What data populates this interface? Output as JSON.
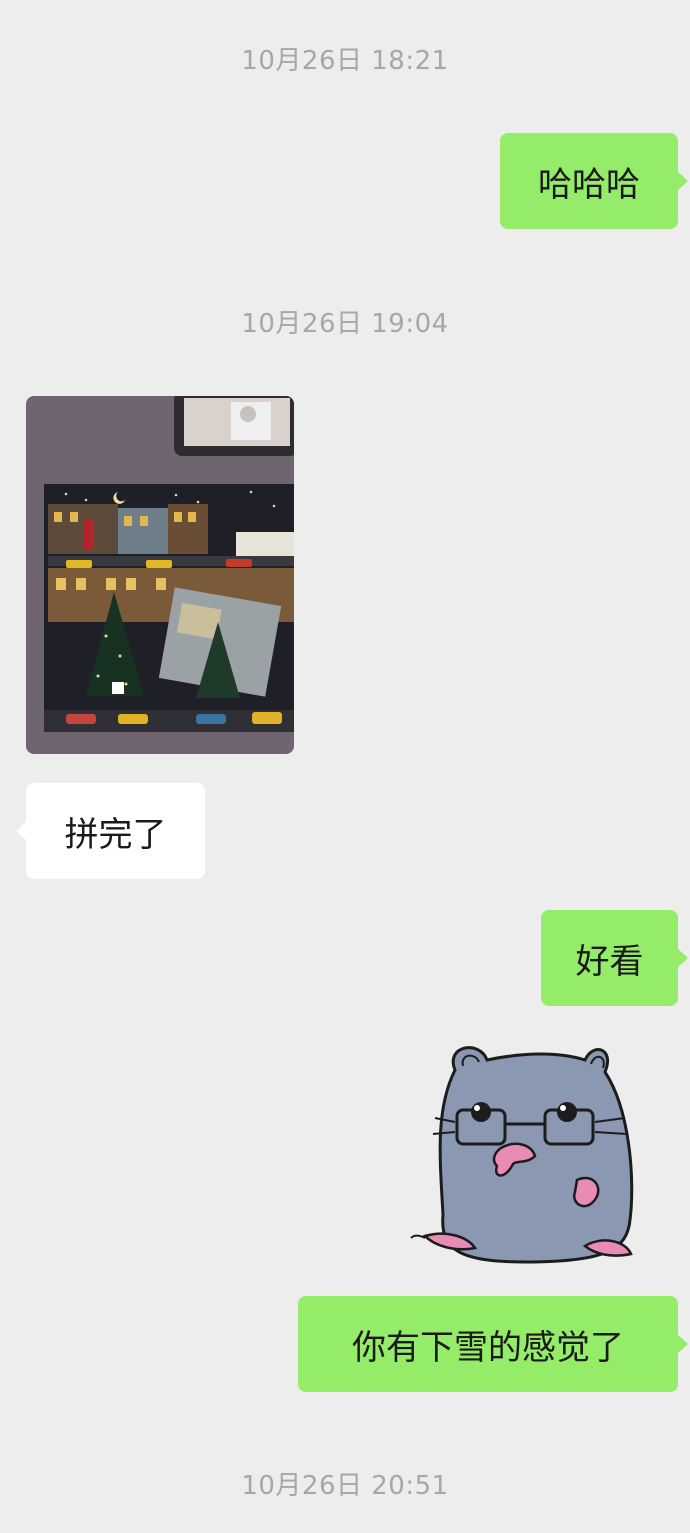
{
  "chat": {
    "timestamps": [
      "10月26日 18:21",
      "10月26日 19:04",
      "10月26日 20:51"
    ],
    "messages": {
      "m1": "哈哈哈",
      "m2": "拼完了",
      "m3": "好看",
      "m4": "你有下雪的感觉了"
    }
  },
  "colors": {
    "background": "#ededed",
    "sent_bubble": "#95ec69",
    "received_bubble": "#ffffff",
    "timestamp_text": "#a7a7a7"
  },
  "icons": {
    "sticker": "hamster-with-glasses-sticker"
  }
}
